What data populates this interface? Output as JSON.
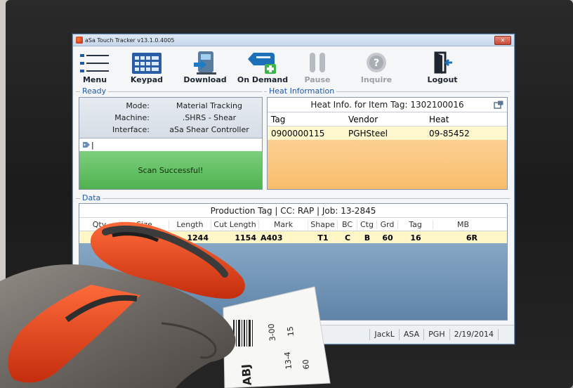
{
  "window": {
    "title": "aSa Touch Tracker v13.1.0.4005",
    "close_label": "✕"
  },
  "toolbar": {
    "items": [
      {
        "label": "Menu",
        "icon": "menu-icon",
        "enabled": true
      },
      {
        "label": "Keypad",
        "icon": "keypad-icon",
        "enabled": true
      },
      {
        "label": "Download",
        "icon": "download-icon",
        "enabled": true
      },
      {
        "label": "On Demand",
        "icon": "on-demand-icon",
        "enabled": true
      },
      {
        "label": "Pause",
        "icon": "pause-icon",
        "enabled": false
      },
      {
        "label": "Inquire",
        "icon": "inquire-icon",
        "enabled": false
      },
      {
        "label": "Logout",
        "icon": "logout-icon",
        "enabled": true
      }
    ]
  },
  "ready": {
    "section_label": "Ready",
    "rows": [
      {
        "key": "Mode:",
        "value": "Material Tracking"
      },
      {
        "key": "Machine:",
        "value": ".SHRS - Shear"
      },
      {
        "key": "Interface:",
        "value": "aSa Shear Controller"
      }
    ],
    "input_value": "|",
    "status": "Scan Successful!"
  },
  "heat": {
    "section_label": "Heat Information",
    "title": "Heat Info. for Item Tag: 1302100016",
    "columns": [
      "Tag",
      "Vendor",
      "Heat"
    ],
    "rows": [
      [
        "0900000115",
        "PGHSteel",
        "09-85452"
      ]
    ]
  },
  "data": {
    "section_label": "Data",
    "title": "Production Tag | CC: RAP | Job: 13-2845",
    "columns": [
      "Qty",
      "Size",
      "Length",
      "Cut Length",
      "Mark",
      "Shape",
      "BC",
      "Ctg",
      "Grd",
      "Tag",
      "MB"
    ],
    "row": [
      "",
      "",
      "1244",
      "1154",
      "A403",
      "T1",
      "C",
      "B",
      "60",
      "16",
      "6R"
    ]
  },
  "statusbar": {
    "user": "JackL",
    "company": "ASA",
    "location": "PGH",
    "date": "2/19/2014"
  },
  "label_card": {
    "texts": [
      "3-00",
      "15",
      "13-4",
      "60",
      "ABJ"
    ]
  },
  "colors": {
    "success_green": "#5cbf5c",
    "heat_orange": "#fbcb87",
    "accent_blue": "#1e5aa8",
    "scanner_orange": "#e8431c"
  }
}
